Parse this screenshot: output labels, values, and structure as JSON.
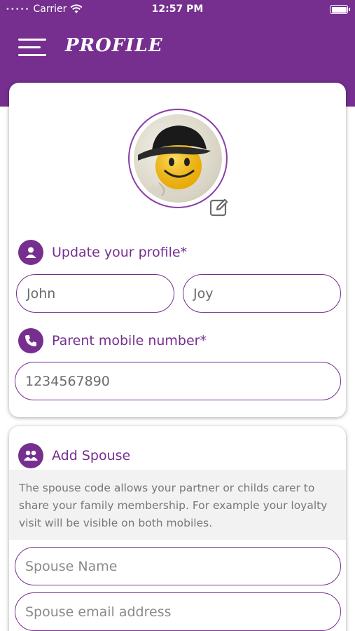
{
  "status_bar": {
    "carrier": "Carrier",
    "time": "12:57 PM"
  },
  "header": {
    "title": "PROFILE"
  },
  "profile": {
    "section_label": "Update your profile*",
    "first_name": "John",
    "last_name": "Joy",
    "mobile_label": "Parent mobile number*",
    "mobile": "1234567890"
  },
  "spouse": {
    "section_label": "Add Spouse",
    "description": "The spouse code allows your partner or childs carer to share your family membership. For example your loyalty visit will be visible on both mobiles.",
    "name_placeholder": "Spouse Name",
    "email_placeholder": "Spouse email address"
  },
  "colors": {
    "brand": "#762f8f"
  }
}
